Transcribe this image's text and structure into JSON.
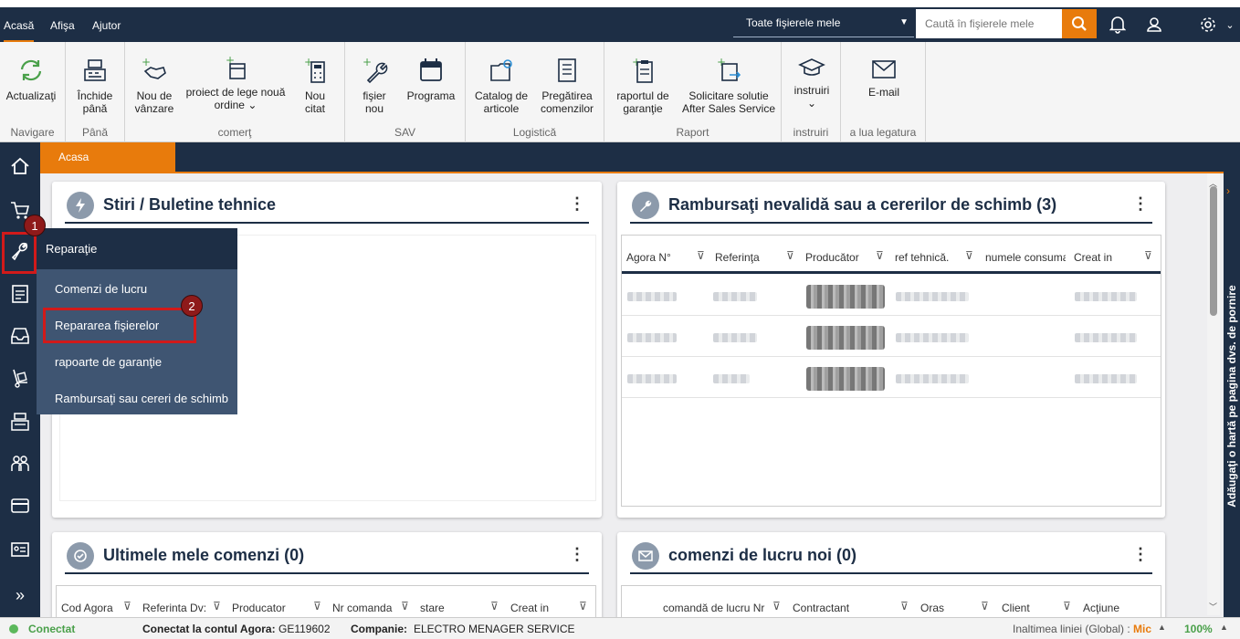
{
  "top": {
    "menus": [
      "Acasă",
      "Afişa",
      "Ajutor"
    ],
    "file_select": "Toate fişierele mele",
    "search_placeholder": "Caută în fişierele mele"
  },
  "ribbon": {
    "groups": [
      {
        "label": "Navigare",
        "buttons": [
          "Actualizaţi"
        ]
      },
      {
        "label": "Până",
        "buttons": [
          "Închide până"
        ]
      },
      {
        "label": "comerţ",
        "buttons": [
          "Nou de vânzare",
          "proiect de lege nouă ordine",
          "Nou citat"
        ]
      },
      {
        "label": "SAV",
        "buttons": [
          "fişier nou",
          "Programa"
        ]
      },
      {
        "label": "Logistică",
        "buttons": [
          "Catalog de articole",
          "Pregătirea comenzilor"
        ]
      },
      {
        "label": "Raport",
        "buttons": [
          "raportul de garanţie",
          "Solicitare solutie After Sales Service"
        ]
      },
      {
        "label": "instruiri",
        "buttons": [
          "instruiri"
        ]
      },
      {
        "label": "a lua legatura",
        "buttons": [
          "E-mail"
        ]
      }
    ]
  },
  "tab": "Acasa",
  "panels": {
    "news": {
      "title": "Stiri / Buletine tehnice"
    },
    "refunds": {
      "title": "Rambursaţi nevalidă sau a cererilor de schimb (3)",
      "columns": [
        "Agora N°",
        "Referinţa",
        "Producător",
        "ref tehnică.",
        "numele consuma",
        "Creat in"
      ]
    },
    "orders": {
      "title": "Ultimele mele comenzi (0)",
      "columns": [
        "Cod Agora",
        "Referinta Dv:",
        "Producator",
        "Nr comanda",
        "stare",
        "Creat in"
      ]
    },
    "workorders": {
      "title": "comenzi de lucru noi (0)",
      "columns": [
        "comandă de lucru Nr",
        "Contractant",
        "Oras",
        "Client",
        "Acţiune"
      ]
    }
  },
  "dropdown": {
    "header": "Reparaţie",
    "items": [
      "Comenzi de lucru",
      "Repararea fişierelor",
      "rapoarte de garanţie",
      "Rambursaţi sau cereri de schimb"
    ]
  },
  "badges": [
    "1",
    "2"
  ],
  "right_tab": "Adăugaţi o hartă pe pagina dvs. de pornire",
  "status": {
    "connected": "Conectat",
    "account_label": "Conectat la contul Agora:",
    "account": "GE119602",
    "company_label": "Companie:",
    "company": "ELECTRO MENAGER SERVICE",
    "row_height_label": "Inaltimea liniei (Global) :",
    "row_height": "Mic",
    "zoom": "100%"
  },
  "colors": {
    "navy": "#1d2e45",
    "accent": "#e87b0c",
    "highlight": "#d11a1a",
    "dropdown": "#3f5572"
  }
}
